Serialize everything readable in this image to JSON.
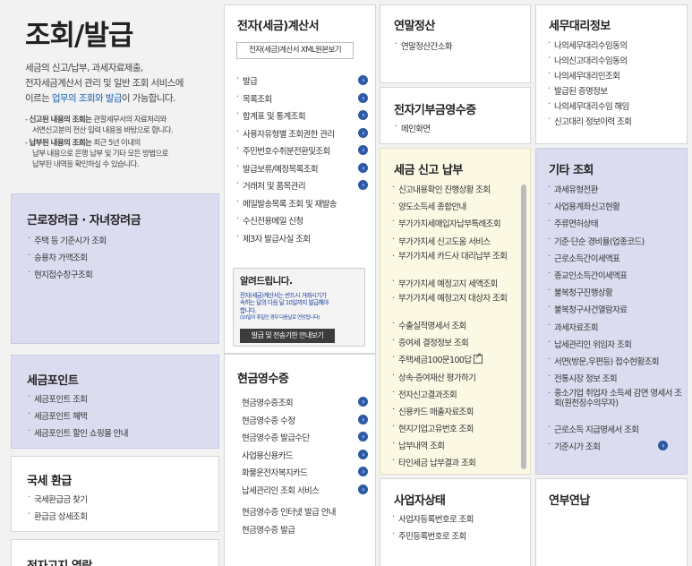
{
  "intro": {
    "title": "조회/발급",
    "desc_line1": "세금의 신고/납부, 과세자료제출,",
    "desc_line2": "전자세금계산서 관리 및 일반 조회 서비스에",
    "desc_line3_pre": "이르는 ",
    "desc_line3_hl": "업무의 조회와 발급",
    "desc_line3_post": "이 가능합니다.",
    "note1_bold": "신고된 내용의 조회는",
    "note1_rest": " 관할세무서의 자료처리와",
    "note1_line2": "서면신고분의 전산 입력 내용을 바탕으로 합니다.",
    "note2_bold": "납부된 내용의 조회는",
    "note2_rest": " 최근 5년 이내의",
    "note2_line2": "납부 내용으로 은행 납부 및 기타 모든 방법으로",
    "note2_line3": "납부된 내역을 확인하실 수 있습니다."
  },
  "earned_income": {
    "title": "근로장려금 · 자녀장려금",
    "items": [
      "주택 등 기준시가 조회",
      "승용차 가액조회",
      "현지접수창구조회"
    ]
  },
  "tax_point": {
    "title": "세금포인트",
    "items": [
      "세금포인트 조회",
      "세금포인트 혜택",
      "세금포인트 할인 쇼핑몰 안내"
    ]
  },
  "refund": {
    "title": "국세 환급",
    "items": [
      "국세환급금 찾기",
      "환급금 상세조회"
    ]
  },
  "notice": {
    "title": "전자고지 열람"
  },
  "e_invoice": {
    "title": "전자(세금)계산서",
    "xml_button": "전자(세금)계산서 XML원본보기",
    "items": [
      "발급",
      "목록조회",
      "합계표 및 통계조회",
      "사용자유형별 조회권한 관리",
      "주민번호수취분전환및조회",
      "발급보류/예정목록조회",
      "거래처 및 품목관리",
      "메일발송목록 조회 및 재발송",
      "수신전용메일 신청",
      "제3자 발급사실 조회"
    ]
  },
  "announce": {
    "title": "알려드립니다.",
    "text1": "전자(세금)계산서는 반드시 거래시기가",
    "text2": "속하는 달의 다음 달 10일까지 발급해야",
    "text3": "합니다.",
    "text4": "(10일이 휴일인 경우 다음날로 연장됩니다)",
    "button": "발급 및 전송기한 안내보기"
  },
  "cash_receipt": {
    "title": "현금영수증",
    "items": [
      "현금영수증조회",
      "현금영수증 수정",
      "현금영수증 발급수단",
      "사업용신용카드",
      "화물운전자복지카드",
      "납세관리인 조회 서비스"
    ],
    "extra": [
      "현금영수증 인터넷 발급 안내",
      "현금영수증 발급"
    ]
  },
  "year_end": {
    "title": "연말정산",
    "items": [
      "연말정산간소화"
    ]
  },
  "donation": {
    "title": "전자기부금영수증",
    "items": [
      "메인화면"
    ]
  },
  "tax_filing": {
    "title": "세금 신고 납부",
    "items": [
      "신고내용확인 진행상황 조회",
      "양도소득세 종합안내",
      "부가가치세매입자납부특례조회",
      "부가가치세 신고도움 서비스",
      "부가가치세 카드사 대리납부 조회",
      "부가가치세 예정고지 세액조회",
      "부가가치세 예정고지 대상자 조회",
      "수출실적명세서 조회",
      "증여세 결정정보 조회",
      "주택세금100문100답",
      "상속·증여재산 평가하기",
      "전자신고결과조회",
      "신용카드 매출자료조회",
      "현지기업고유번호 조회",
      "납부내역 조회",
      "타인세금 납부결과 조회"
    ]
  },
  "business_status": {
    "title": "사업자상태",
    "items": [
      "사업자등록번호로 조회",
      "주민등록번호로 조회"
    ]
  },
  "agent_info": {
    "title": "세무대리정보",
    "items": [
      "나의세무대리수임동의",
      "나의신고대리수임동의",
      "나의세무대리인조회",
      "발급된 증명정보",
      "나의세무대리수임 해임",
      "신고대리 정보이력 조회"
    ]
  },
  "other": {
    "title": "기타 조회",
    "items": [
      "과세유형전환",
      "사업용계좌신고현황",
      "주류면허상태",
      "기준·단순 경비율(업종코드)",
      "근로소득간이세액표",
      "종교인소득간이세액표",
      "불복청구진행상황",
      "불복청구사건열람자료",
      "과세자료조회",
      "납세관리인 위임자 조회",
      "서면(방문,우편등) 접수현황조회",
      "전통시장 정보 조회",
      "중소기업 취업자 소득세 감면 명세서 조회(원천징수의무자)",
      "근로소득 지급명세서 조회",
      "기준시가 조회"
    ]
  },
  "pension": {
    "title": "연부연납"
  },
  "colors": {
    "highlight": "#1a5fb4",
    "purple_panel": "#dcdcf0",
    "yellow_panel": "#fbf8e4",
    "arrow": "#2d5aa6"
  }
}
